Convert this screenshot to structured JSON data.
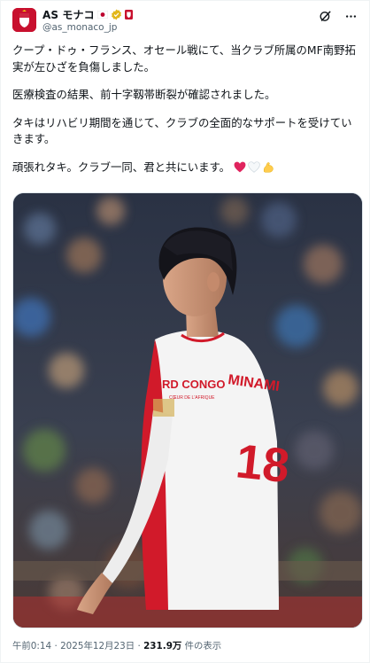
{
  "account": {
    "display_name": "AS モナコ",
    "handle": "@as_monaco_jp",
    "flag_icon": "japan-flag-icon",
    "verified_icon": "gold-verified-badge-icon",
    "affiliate_icon": "club-crest-badge-icon",
    "brand_color": "#c8102e"
  },
  "post": {
    "paragraphs": [
      "クープ・ドゥ・フランス、オセール戦にて、当クラブ所属のMF南野拓実が左ひざを負傷しました。",
      "医療検査の結果、前十字靱帯断裂が確認されました。",
      "タキはリハビリ期間を通じて、クラブの全面的なサポートを受けていきます。",
      "頑張れタキ。クラブ一同、君と共にいます。"
    ],
    "emojis": [
      "red-heart-icon",
      "white-heart-icon",
      "flexed-biceps-icon"
    ]
  },
  "media": {
    "jersey_sponsor": "RD CONGO",
    "jersey_name": "MINAMI",
    "jersey_number": "18",
    "jersey_tagline": "CŒUR DE L'AFRIQUE"
  },
  "meta": {
    "time": "午前0:14",
    "separator": "·",
    "date": "2025年12月23日",
    "views_count": "231.9万",
    "views_label": "件の表示"
  }
}
